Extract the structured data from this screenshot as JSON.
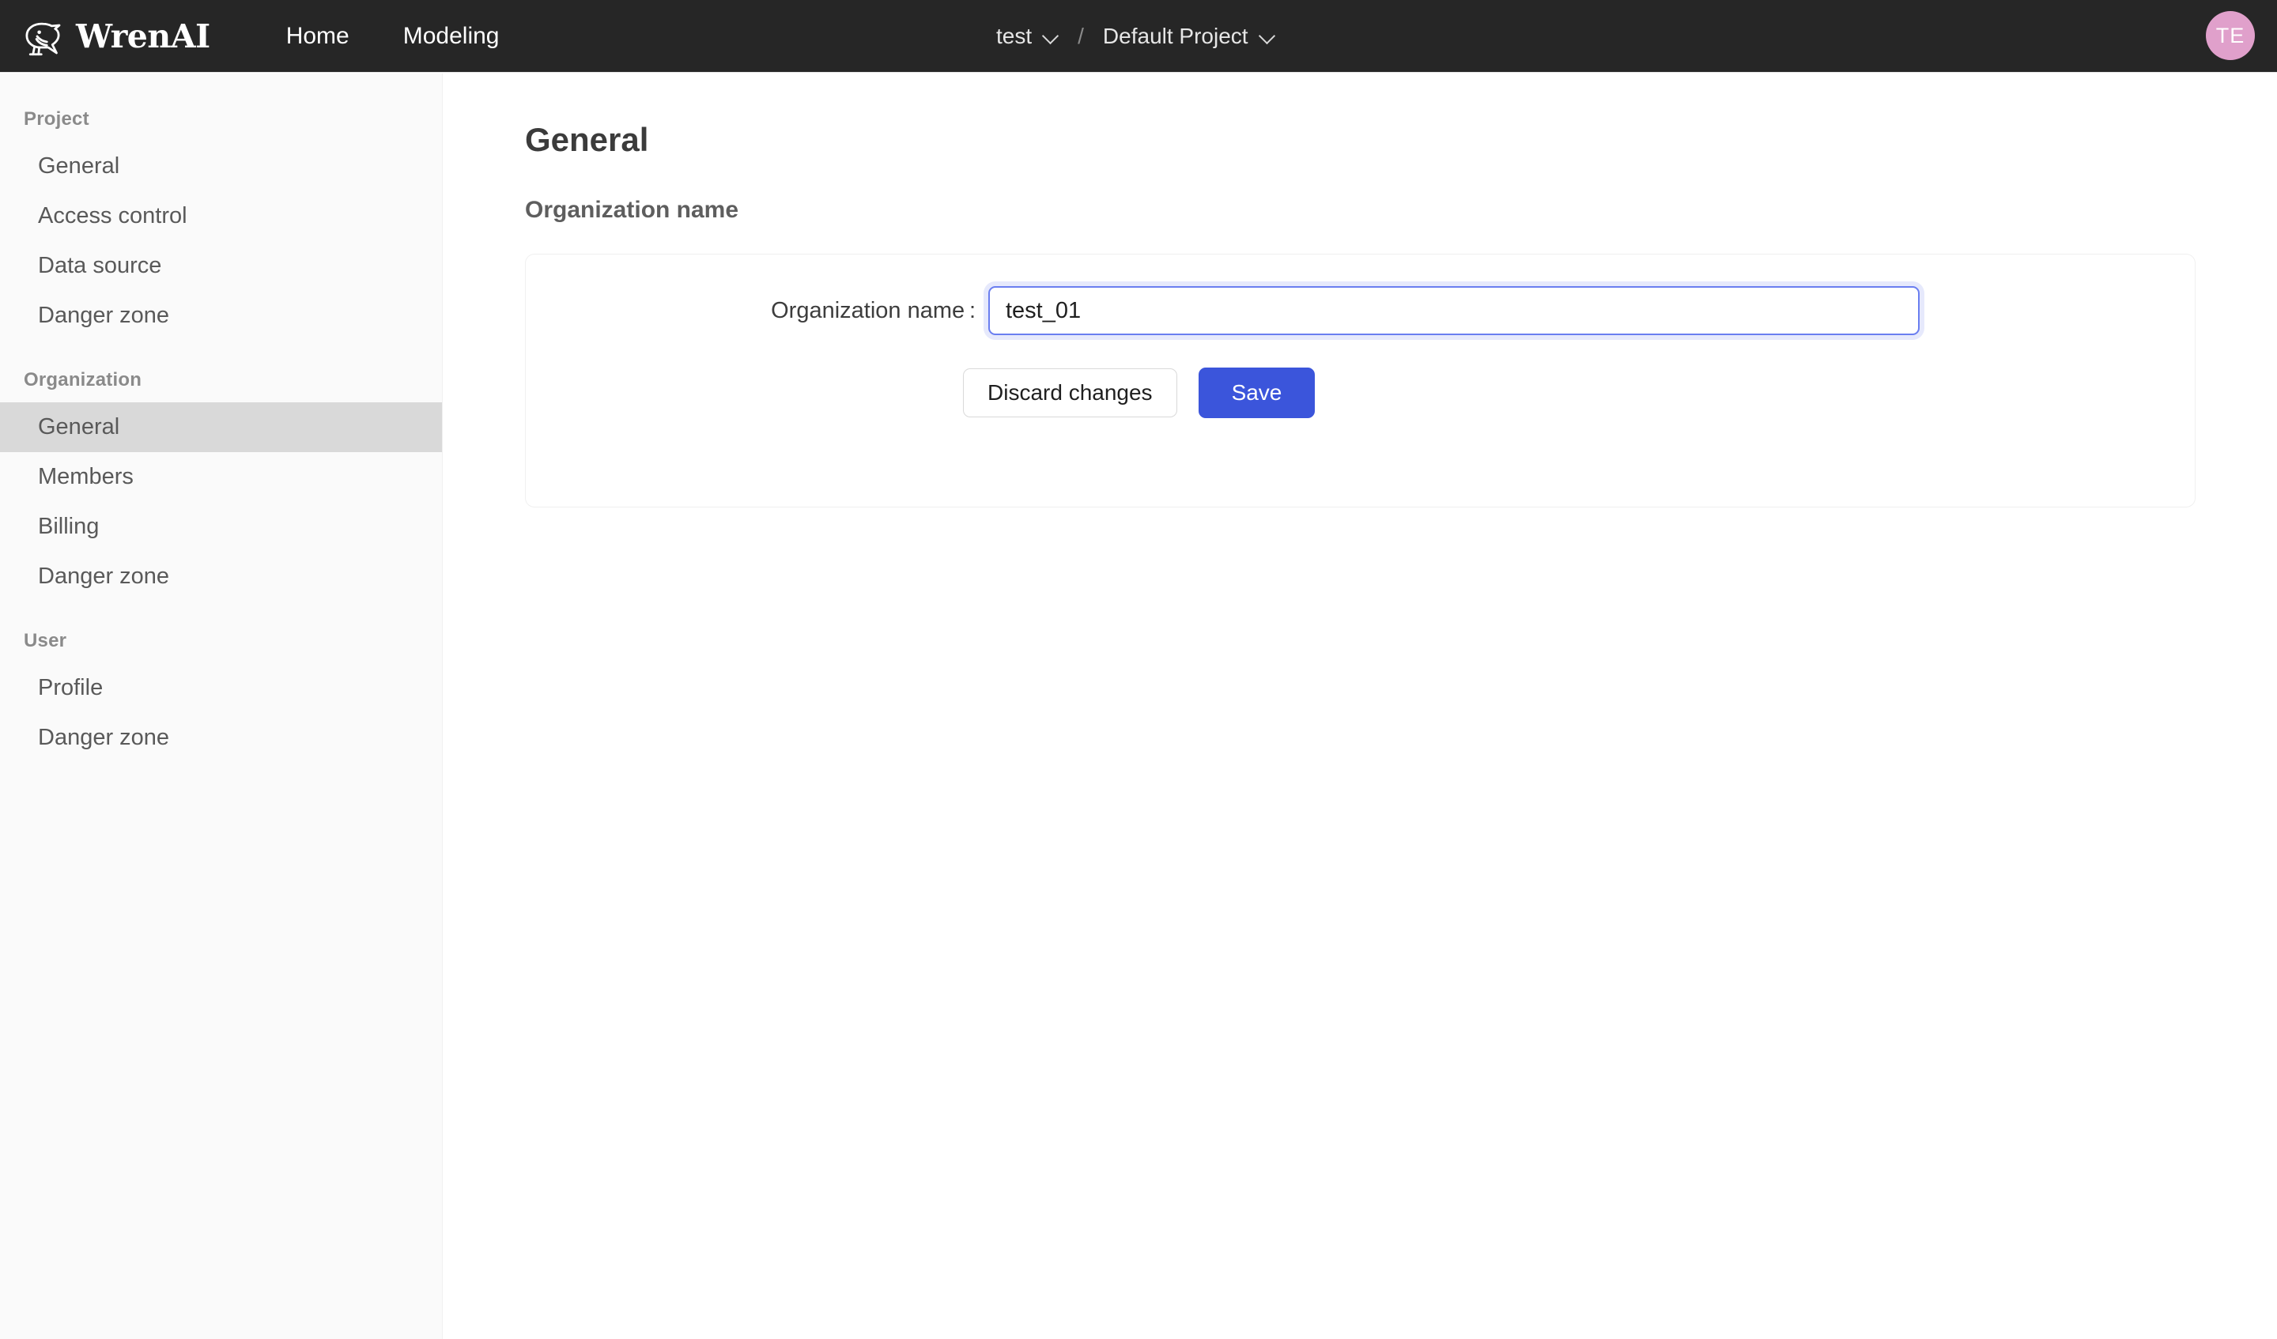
{
  "header": {
    "brand_name": "WrenAI",
    "brand_logo_icon": "wren-bird-logo-icon",
    "nav": [
      {
        "label": "Home"
      },
      {
        "label": "Modeling"
      }
    ],
    "breadcrumb": {
      "organization": "test",
      "separator": "/",
      "project": "Default Project",
      "chevron_icon": "chevron-down-icon"
    },
    "avatar": {
      "initials": "TE",
      "background_color": "#e0a0cb"
    },
    "background_color": "#262626"
  },
  "sidebar": {
    "groups": [
      {
        "title": "Project",
        "items": [
          {
            "label": "General",
            "active": false
          },
          {
            "label": "Access control",
            "active": false
          },
          {
            "label": "Data source",
            "active": false
          },
          {
            "label": "Danger zone",
            "active": false
          }
        ]
      },
      {
        "title": "Organization",
        "items": [
          {
            "label": "General",
            "active": true
          },
          {
            "label": "Members",
            "active": false
          },
          {
            "label": "Billing",
            "active": false
          },
          {
            "label": "Danger zone",
            "active": false
          }
        ]
      },
      {
        "title": "User",
        "items": [
          {
            "label": "Profile",
            "active": false
          },
          {
            "label": "Danger zone",
            "active": false
          }
        ]
      }
    ],
    "active_background_color": "#d9d9d9",
    "background_color": "#fafafa"
  },
  "main": {
    "page_title": "General",
    "section_title": "Organization name",
    "form": {
      "field_label": "Organization name :",
      "field_value": "test_01",
      "field_placeholder": "",
      "focus_border_color": "#6a7ef0"
    },
    "buttons": {
      "discard_label": "Discard changes",
      "save_label": "Save",
      "save_color": "#3b55db"
    }
  }
}
